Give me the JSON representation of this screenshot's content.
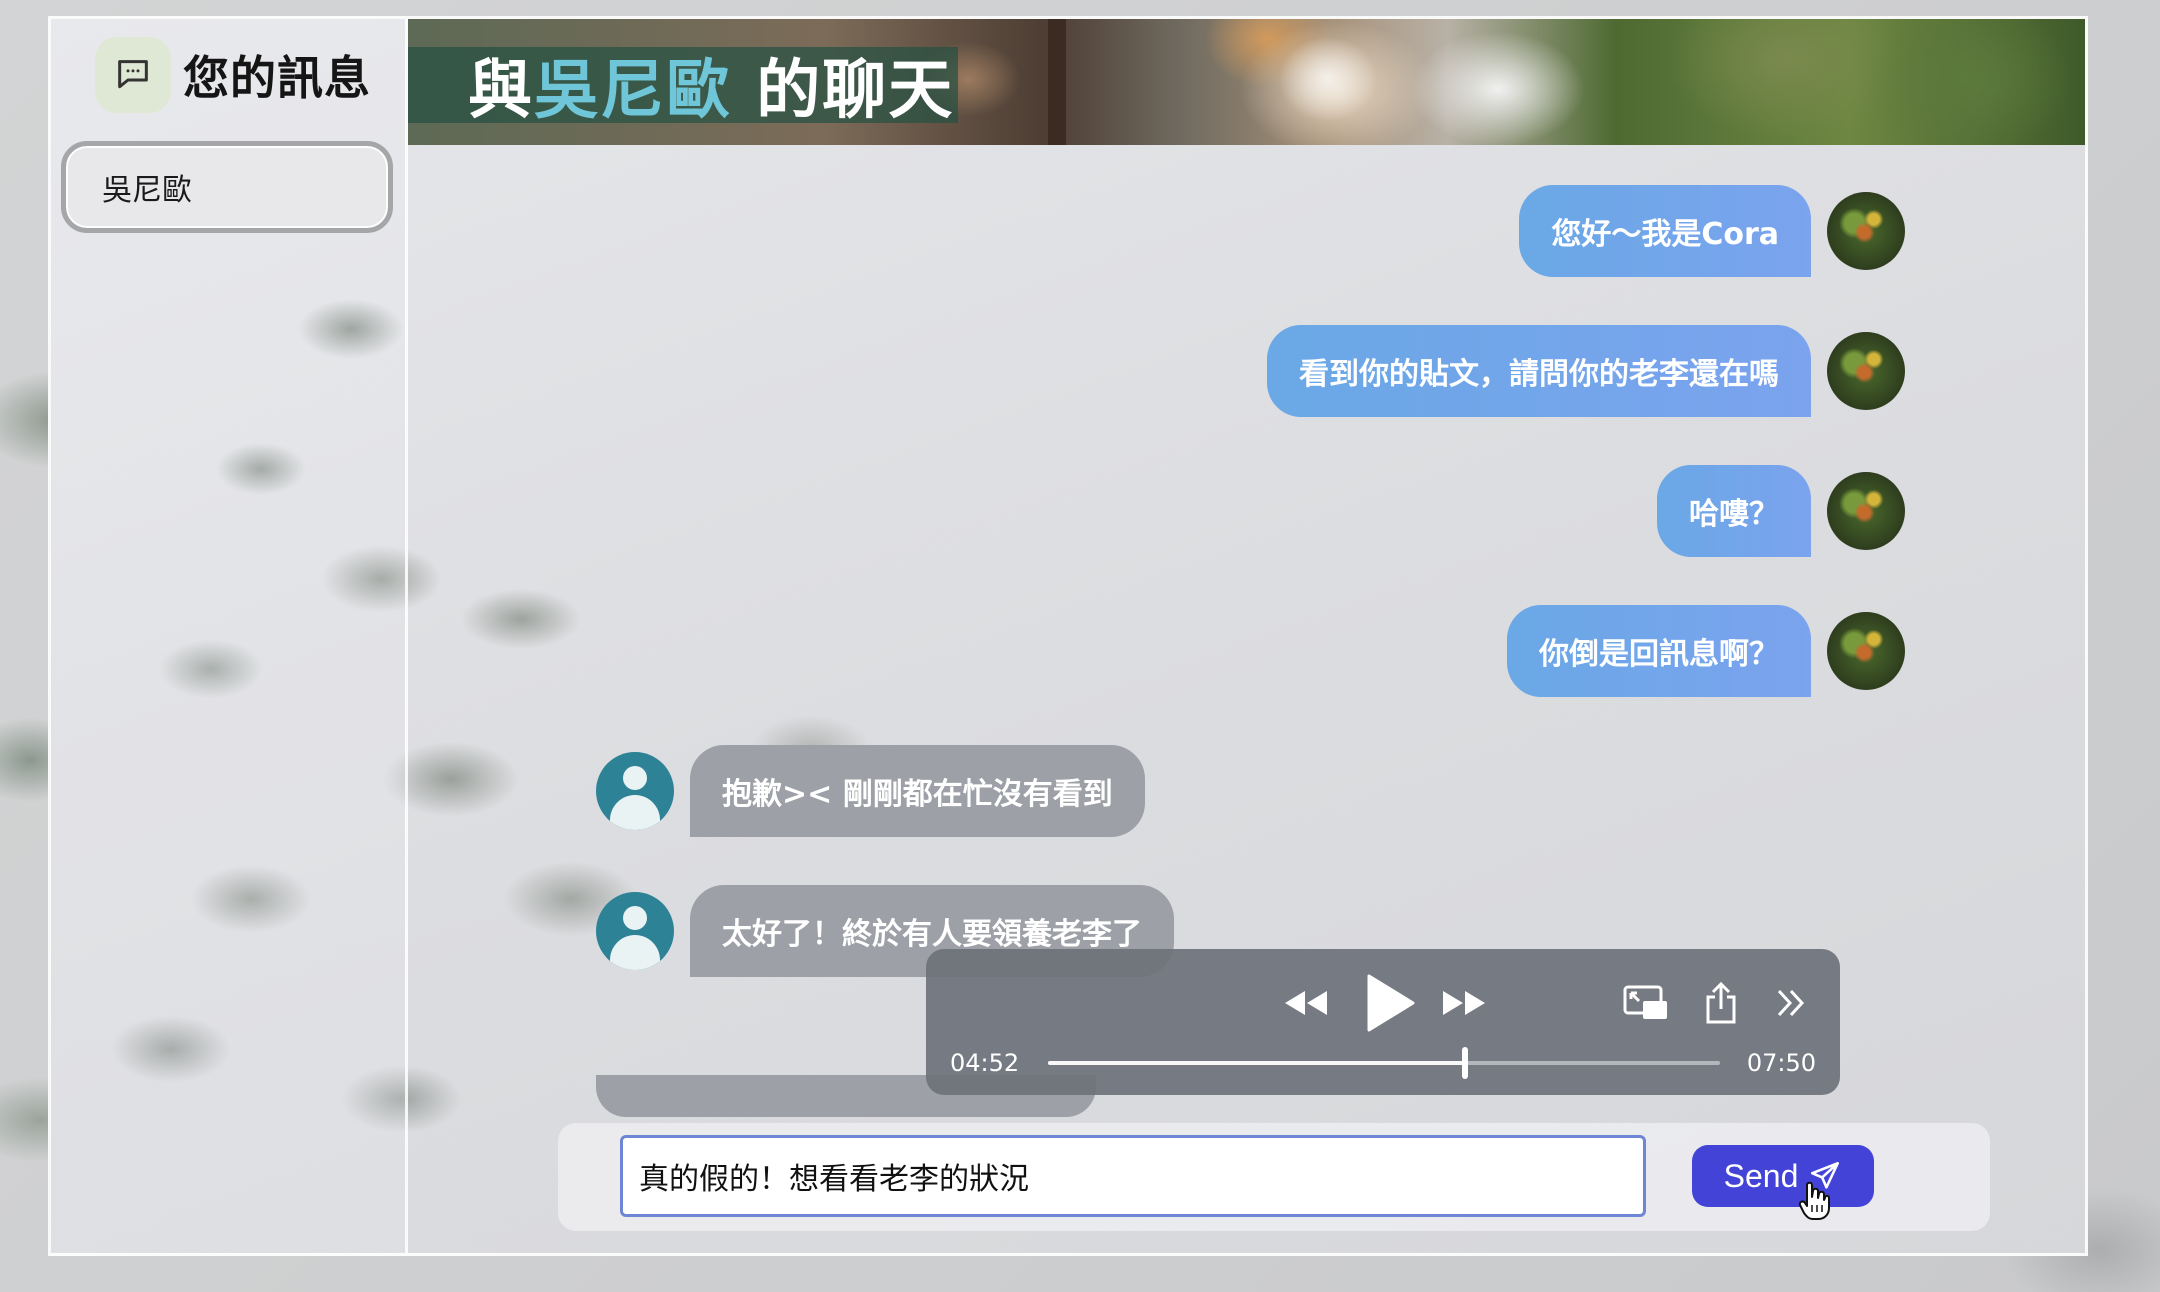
{
  "sidebar": {
    "title": "您的訊息",
    "icon": "chat-bubble-icon",
    "contacts": [
      {
        "name": "吳尼歐"
      }
    ]
  },
  "banner": {
    "prefix": "與",
    "name": "吳尼歐",
    "suffix": " 的聊天"
  },
  "messages": [
    {
      "from": "me",
      "text": "您好～我是Cora"
    },
    {
      "from": "me",
      "text": "看到你的貼文，請問你的老李還在嗎"
    },
    {
      "from": "me",
      "text": "哈嘍？"
    },
    {
      "from": "me",
      "text": "你倒是回訊息啊？"
    },
    {
      "from": "them",
      "text": "抱歉>< 剛剛都在忙沒有看到"
    },
    {
      "from": "them",
      "text": "太好了！終於有人要領養老李了"
    }
  ],
  "player": {
    "elapsed": "04:52",
    "duration": "07:50",
    "progress": 0.62
  },
  "composer": {
    "input_value": "真的假的！想看看老李的狀況",
    "send_label": "Send"
  },
  "colors": {
    "outgoing_bubble": "#6aa8e6",
    "incoming_bubble": "#9da0a6",
    "send_button": "#4343d8",
    "banner_highlight": "#6fc6d8"
  }
}
